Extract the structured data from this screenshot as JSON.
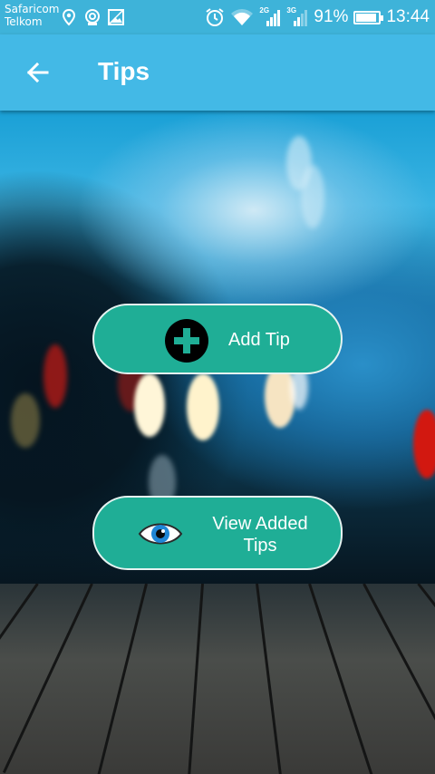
{
  "status_bar": {
    "carrier_1": "Safaricom",
    "carrier_2": "Telkom",
    "signal_1_label": "2G",
    "signal_2_label": "3G",
    "battery_percent": "91%",
    "battery_level": 0.91,
    "time": "13:44",
    "icons": [
      "location-icon",
      "hotspot-icon",
      "image-icon",
      "alarm-icon",
      "wifi-icon",
      "signal-icon",
      "signal-icon",
      "battery-icon"
    ]
  },
  "app_bar": {
    "title": "Tips",
    "back_icon": "arrow-left-icon",
    "color": "#43b9e6"
  },
  "actions": {
    "add_tip": {
      "label": "Add Tip",
      "icon": "plus-circle-icon"
    },
    "view_tips": {
      "label_line_1": "View Added",
      "label_line_2": "Tips",
      "icon": "eye-icon"
    }
  },
  "colors": {
    "status_bar": "#3eb3d9",
    "button": "#1fae96",
    "button_border": "#e6f3f1"
  }
}
